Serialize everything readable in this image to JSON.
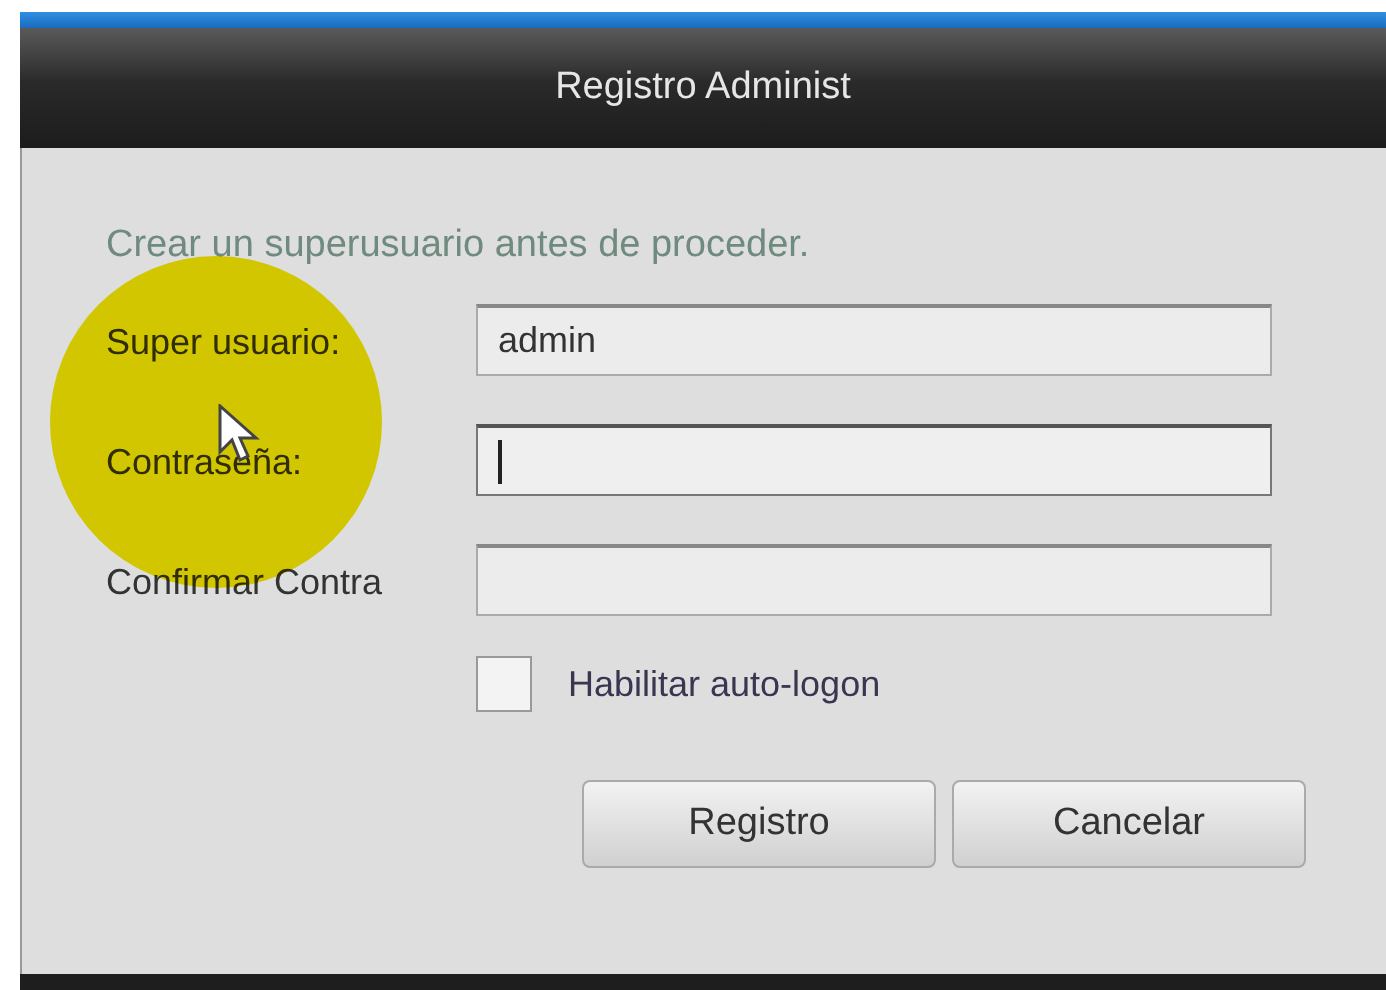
{
  "window": {
    "title": "Registro Administ"
  },
  "intro": "Crear un superusuario antes de proceder.",
  "fields": [
    {
      "label": "Super usuario:",
      "value": "admin",
      "focused": false
    },
    {
      "label": "Contraseña:",
      "focused": true
    },
    {
      "label": "Confirmar Contra",
      "focused": false
    }
  ],
  "checkbox": {
    "label": "Habilitar auto-logon",
    "checked": false
  },
  "buttons": [
    "Registro",
    "Cancelar"
  ]
}
